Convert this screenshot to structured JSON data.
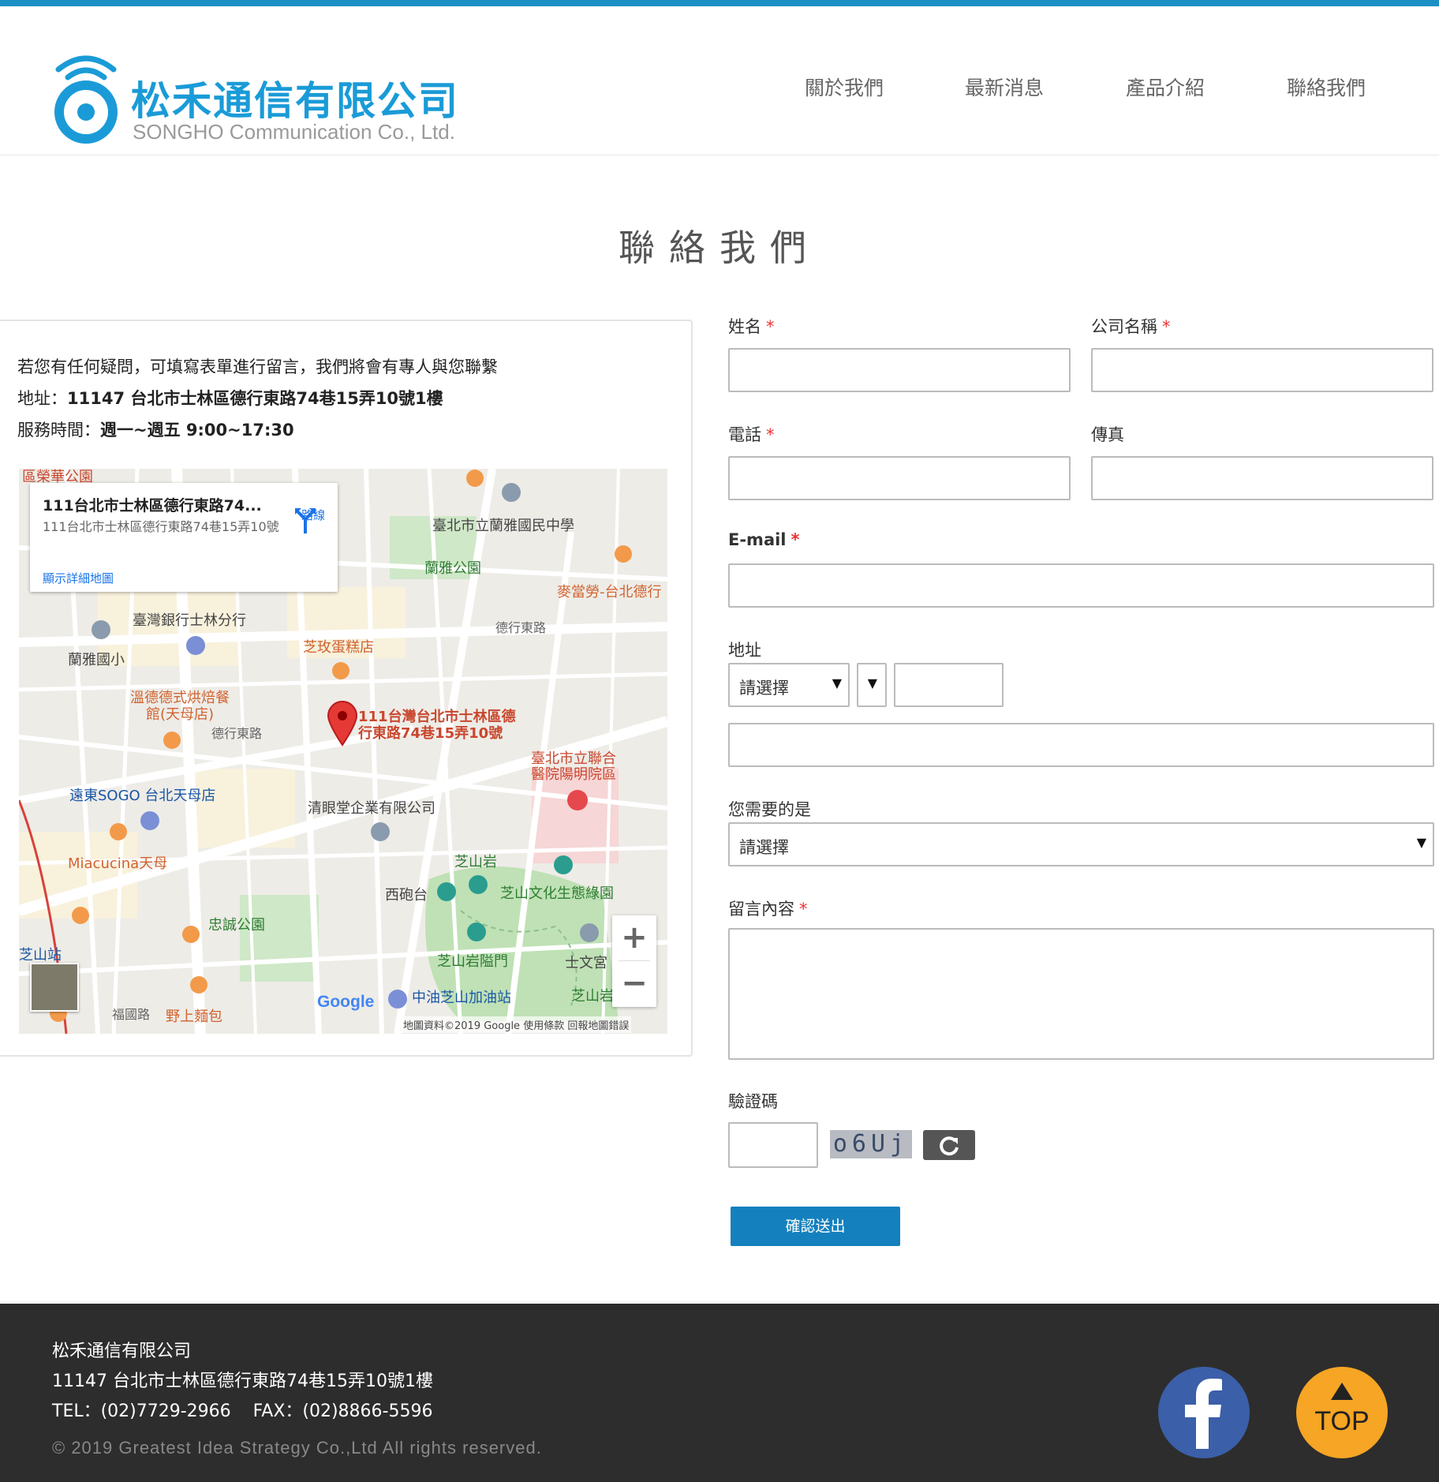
{
  "header": {
    "logo_cn": "松禾通信有限公司",
    "logo_en": "SONGHO Communication Co., Ltd.",
    "nav": [
      "關於我們",
      "最新消息",
      "產品介紹",
      "聯絡我們"
    ]
  },
  "page_title": "聯絡我們",
  "info": {
    "intro": "若您有任何疑問，可填寫表單進行留言，我們將會有專人與您聯繫",
    "address_label": "地址：",
    "address": "11147 台北市士林區德行東路74巷15弄10號1樓",
    "hours_label": "服務時間：",
    "hours": "週一~週五 9:00~17:30"
  },
  "map": {
    "infobox_title": "111台北市士林區德行東路74...",
    "infobox_address": "111台北市士林區德行東路74巷15弄10號",
    "infobox_link": "顯示詳細地圖",
    "directions": "路線",
    "marker_label": "111台灣台北市士林區德行東路74巷15弄10號",
    "labels": [
      "區榮華公園",
      "臺北市立蘭雅國民中學",
      "蘭雅公園",
      "麥當勞-台北德行",
      "臺灣銀行士林分行",
      "蘭雅國小",
      "芝玫蛋糕店",
      "德行東路",
      "溫德德式烘焙餐館(天母店)",
      "德行東路",
      "臺北市立聯合醫院陽明院區",
      "遠東SOGO 台北天母店",
      "清眼堂企業有限公司",
      "Miacucina天母",
      "芝山岩",
      "西砲台",
      "芝山文化生態綠園",
      "忠誠公園",
      "芝山站",
      "芝山岩隘門",
      "士文宮",
      "福國路",
      "野上麵包",
      "中油芝山加油站",
      "芝山岩"
    ],
    "attribution": "地圖資料©2019 Google  使用條款  回報地圖錯誤",
    "google": "Google"
  },
  "form": {
    "name_label": "姓名",
    "company_label": "公司名稱",
    "phone_label": "電話",
    "fax_label": "傳真",
    "email_label": "E-mail",
    "address_label": "地址",
    "city_select": "請選擇",
    "need_label": "您需要的是",
    "need_select": "請選擇",
    "message_label": "留言內容",
    "captcha_label": "驗證碼",
    "captcha_text": "o6Uj",
    "submit_label": "確認送出",
    "required_mark": "*"
  },
  "footer": {
    "company": "松禾通信有限公司",
    "address": "11147 台北市士林區德行東路74巷15弄10號1樓",
    "contact": "TEL：(02)7729-2966    FAX：(02)8866-5596",
    "copyright": "© 2019 Greatest Idea Strategy Co.,Ltd All rights reserved.",
    "top_label": "TOP"
  },
  "colors": {
    "accent": "#1a8fc4",
    "button": "#1480bd",
    "footer_bg": "#2d2d2d",
    "required": "#e33333",
    "facebook": "#3b5fa8",
    "top_button": "#f6a524"
  }
}
